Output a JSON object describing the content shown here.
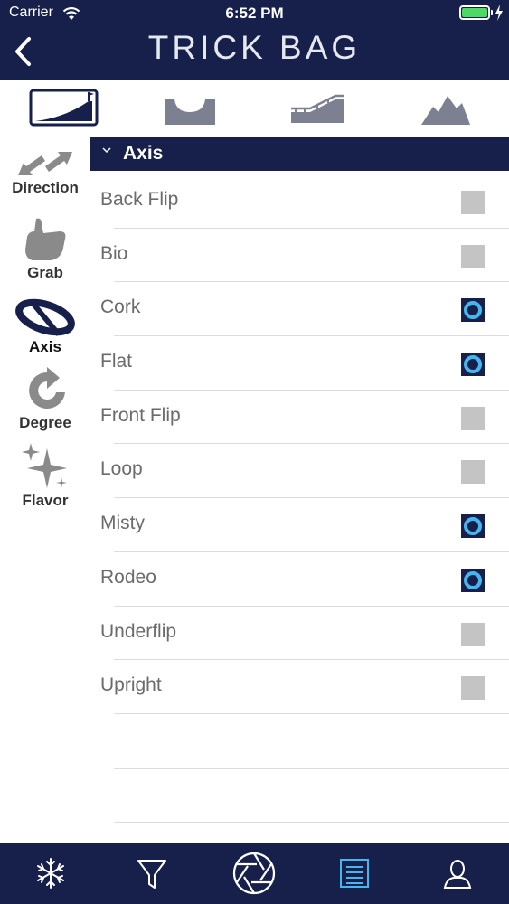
{
  "status_bar": {
    "carrier": "Carrier",
    "time": "6:52 PM"
  },
  "nav": {
    "title": "TRICK BAG",
    "back_icon": "chevron-left-icon"
  },
  "terrain_tabs": [
    {
      "name": "jump",
      "icon": "jump-icon",
      "selected": true
    },
    {
      "name": "halfpipe",
      "icon": "halfpipe-icon",
      "selected": false
    },
    {
      "name": "rail",
      "icon": "rail-icon",
      "selected": false
    },
    {
      "name": "backcountry",
      "icon": "mountain-icon",
      "selected": false
    }
  ],
  "categories": [
    {
      "label": "Direction",
      "icon": "arrows-icon",
      "active": false
    },
    {
      "label": "Grab",
      "icon": "hand-icon",
      "active": false
    },
    {
      "label": "Axis",
      "icon": "axis-icon",
      "active": true
    },
    {
      "label": "Degree",
      "icon": "rotate-icon",
      "active": false
    },
    {
      "label": "Flavor",
      "icon": "sparkle-icon",
      "active": false
    }
  ],
  "section": {
    "title": "Axis",
    "expanded": true
  },
  "items": [
    {
      "label": "Back Flip",
      "checked": false
    },
    {
      "label": "Bio",
      "checked": false
    },
    {
      "label": "Cork",
      "checked": true
    },
    {
      "label": "Flat",
      "checked": true
    },
    {
      "label": "Front Flip",
      "checked": false
    },
    {
      "label": "Loop",
      "checked": false
    },
    {
      "label": "Misty",
      "checked": true
    },
    {
      "label": "Rodeo",
      "checked": true
    },
    {
      "label": "Underflip",
      "checked": false
    },
    {
      "label": "Upright",
      "checked": false
    }
  ],
  "tab_bar": [
    {
      "name": "snowflake-tab",
      "icon": "snowflake-icon",
      "active": false
    },
    {
      "name": "filter-tab",
      "icon": "filter-icon",
      "active": false
    },
    {
      "name": "aperture-tab",
      "icon": "aperture-icon",
      "active": false
    },
    {
      "name": "list-tab",
      "icon": "list-icon",
      "active": true
    },
    {
      "name": "profile-tab",
      "icon": "user-icon",
      "active": false
    }
  ],
  "colors": {
    "navy": "#16204a",
    "accent": "#46b7ee",
    "unchecked": "#c4c4c4",
    "battery": "#4cd964"
  }
}
